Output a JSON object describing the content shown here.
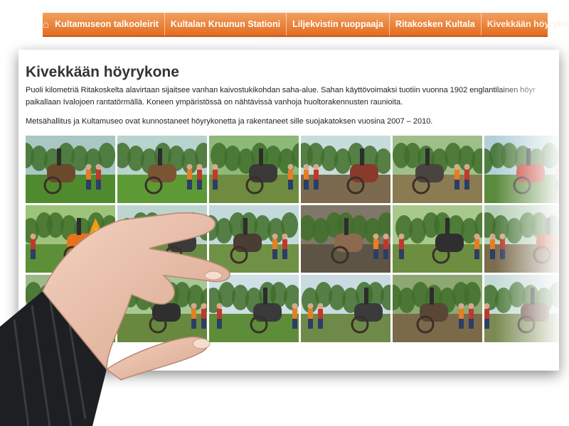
{
  "nav": {
    "icon": "home-icon",
    "items": [
      {
        "label": "Kultamuseon talkooleirit"
      },
      {
        "label": "Kultalan Kruunun Stationi"
      },
      {
        "label": "Liljekvistin ruoppaaja"
      },
      {
        "label": "Ritakosken Kultala"
      },
      {
        "label": "Kivekkään höyrykone",
        "active": true
      }
    ]
  },
  "article": {
    "title": "Kivekkään höyrykone",
    "paragraph1_line1": "Puoli kilometriä Ritakoskelta alavirtaan sijaitsee vanhan kaivostukikohdan saha-alue. Sahan käyttövoimaksi tuotiin vuonna 1902 englantilainen höyr",
    "paragraph1_line2": "paikallaan Ivalojoen rantatörmällä. Koneen ympäristössä on nähtävissä vanhoja huoltorakennusten raunioita.",
    "paragraph2": "Metsähallitus ja Kultamuseo ovat kunnostaneet höyrykonetta ja rakentaneet sille suojakatoksen vuosina 2007 – 2010."
  },
  "gallery": {
    "rows": 3,
    "columns": 6,
    "photos": [
      {
        "subject": "forest-machine-photo",
        "sky": "#a9c7c4",
        "ground": "#4f8a2e",
        "accent": "#6b4a2c"
      },
      {
        "subject": "forest-clearing-photo",
        "sky": "#b9d3cf",
        "ground": "#5d9a36",
        "accent": "#7a5534"
      },
      {
        "subject": "boiler-workers-photo",
        "sky": "#8fb97a",
        "ground": "#6e8b3f",
        "accent": "#3b3a38"
      },
      {
        "subject": "logs-hauling-photo",
        "sky": "#c8dcdc",
        "ground": "#7b6a4e",
        "accent": "#8a3a2a"
      },
      {
        "subject": "engine-wheel-photo",
        "sky": "#9fbf8a",
        "ground": "#8a7b52",
        "accent": "#4a4440"
      },
      {
        "subject": "worker-lifting-photo",
        "sky": "#b3d0d9",
        "ground": "#5a8a3c",
        "accent": "#c0392b"
      },
      {
        "subject": "bonfire-photo",
        "sky": "#9ec37a",
        "ground": "#5c8f37",
        "accent": "#e8731f"
      },
      {
        "subject": "site-overview-photo",
        "sky": "#bcd5cf",
        "ground": "#6a8d44",
        "accent": "#3a3a3a"
      },
      {
        "subject": "group-at-engine-photo",
        "sky": "#c3d9dc",
        "ground": "#6f9146",
        "accent": "#4a3d33"
      },
      {
        "subject": "flywheel-closeup-photo",
        "sky": "#7f7767",
        "ground": "#5d5446",
        "accent": "#8b6a4d"
      },
      {
        "subject": "boiler-on-wheels-photo",
        "sky": "#a9c98c",
        "ground": "#6d8d40",
        "accent": "#2f2f2f"
      },
      {
        "subject": "timber-work-photo",
        "sky": "#b7cfb9",
        "ground": "#7a6c4d",
        "accent": "#b44a2a"
      },
      {
        "subject": "boiler-rear-photo",
        "sky": "#9db989",
        "ground": "#5a7a3a",
        "accent": "#5a4a3c"
      },
      {
        "subject": "engine-side-photo",
        "sky": "#a7c796",
        "ground": "#67883e",
        "accent": "#2f2f2f"
      },
      {
        "subject": "chimney-worker-photo",
        "sky": "#cfe0e6",
        "ground": "#5e8d3a",
        "accent": "#3a3a3a"
      },
      {
        "subject": "boiler-chimney-photo",
        "sky": "#c9dbe1",
        "ground": "#6f8a48",
        "accent": "#3b3b3b"
      },
      {
        "subject": "wheel-assembly-photo",
        "sky": "#8ea874",
        "ground": "#7b6a4a",
        "accent": "#5a4636"
      },
      {
        "subject": "engine-on-logs-photo",
        "sky": "#c5dbd7",
        "ground": "#7a8a52",
        "accent": "#6a4a3a"
      }
    ]
  },
  "colors": {
    "nav_bg": "#e36d1f",
    "title": "#333333",
    "body_text": "#222222"
  }
}
